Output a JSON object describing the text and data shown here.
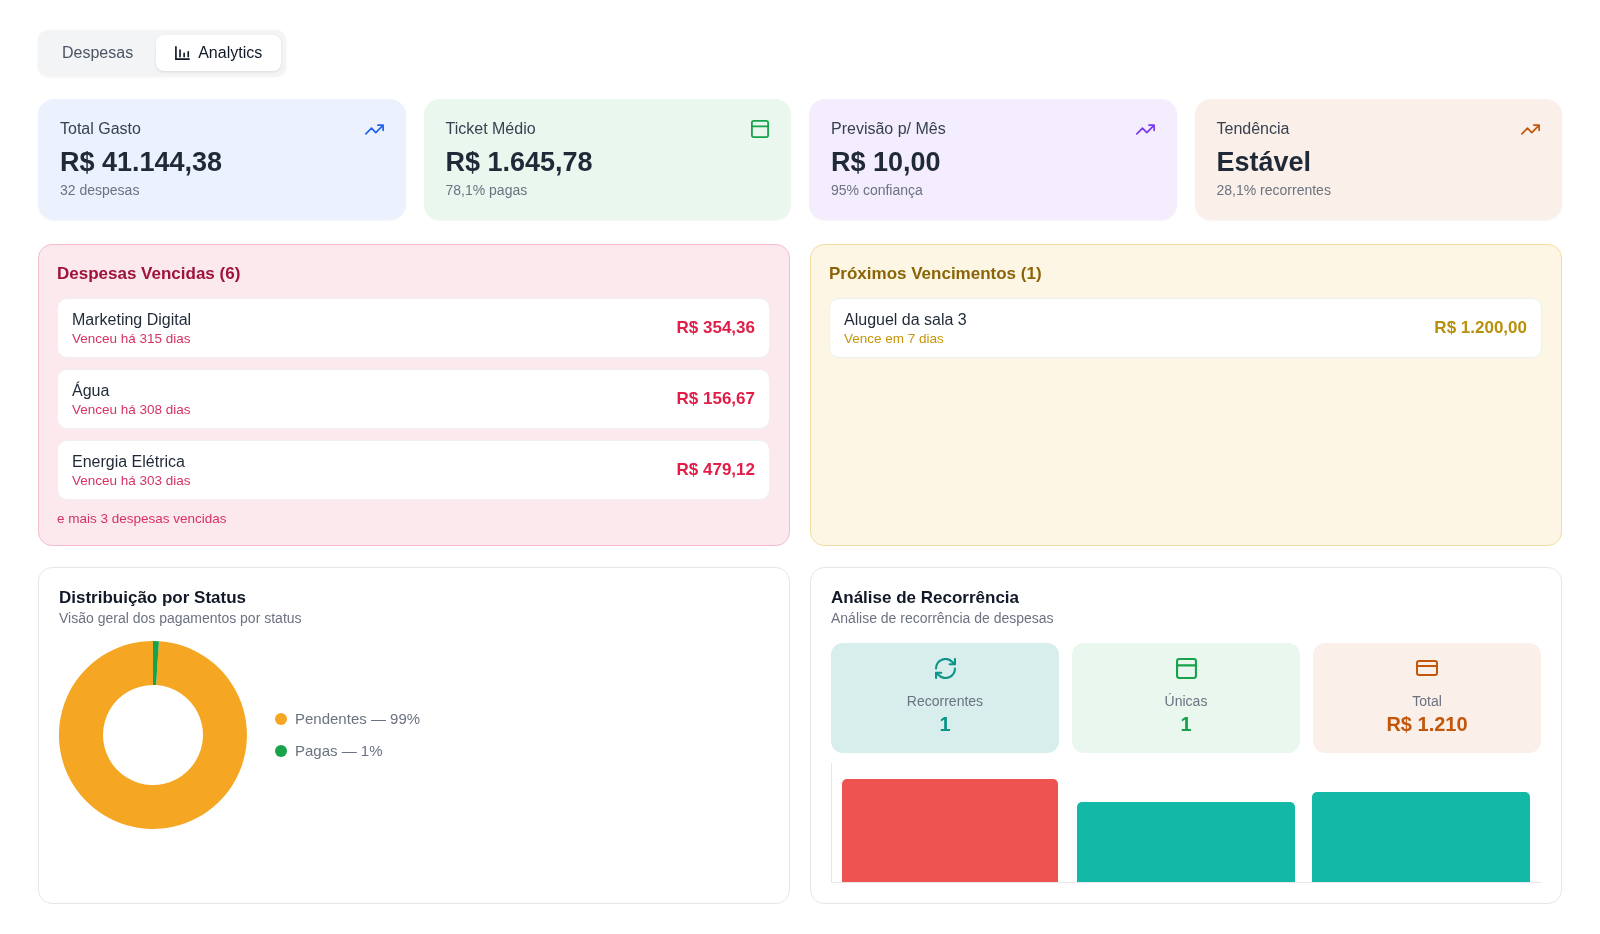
{
  "tabs": [
    {
      "label": "Despesas",
      "selected": false,
      "kind": "plain"
    },
    {
      "label": "Analytics",
      "selected": true,
      "kind": "with-icon"
    }
  ],
  "stats": [
    {
      "title": "Total Gasto",
      "value": "R$ 41.144,38",
      "note": "32 despesas",
      "kind": "trend",
      "color": "#2563eb"
    },
    {
      "title": "Ticket Médio",
      "value": "R$ 1.645,78",
      "note": "78,1% pagas",
      "kind": "window",
      "color": "#16a34a"
    },
    {
      "title": "Previsão p/ Mês",
      "value": "R$ 10,00",
      "note": "95% confiança",
      "kind": "trend",
      "color": "#7c3aed"
    },
    {
      "title": "Tendência",
      "value": "Estável",
      "note": "28,1% recorrentes",
      "kind": "trend",
      "color": "#c2570c"
    }
  ],
  "overdue": {
    "title": "Despesas Vencidas (6)",
    "items": [
      {
        "name": "Marketing Digital",
        "due": "Venceu há 315 dias",
        "amount": "R$ 354,36"
      },
      {
        "name": "Água",
        "due": "Venceu há 308 dias",
        "amount": "R$ 156,67"
      },
      {
        "name": "Energia Elétrica",
        "due": "Venceu há 303 dias",
        "amount": "R$ 479,12"
      }
    ],
    "more": "e mais 3 despesas vencidas"
  },
  "upcoming": {
    "title": "Próximos Vencimentos (1)",
    "items": [
      {
        "name": "Aluguel da sala 3",
        "due": "Vence em 7 dias",
        "amount": "R$ 1.200,00"
      }
    ]
  },
  "distribution": {
    "title": "Distribuição por Status",
    "subtitle": "Visão geral dos pagamentos por status",
    "chart_data": {
      "type": "donut",
      "categories": [
        "Pendentes — 99%",
        "Pagas — 1%"
      ],
      "values": [
        99,
        1
      ],
      "legend": "right"
    },
    "slices": [
      {
        "color": "#f5a623"
      },
      {
        "color": "#16a34a"
      }
    ]
  },
  "recurrence": {
    "title": "Análise de Recorrência",
    "subtitle": "Análise de recorrência de despesas",
    "metrics": [
      {
        "label": "Recorrentes",
        "value": "1",
        "kind": "cycle",
        "color": "#0d9488"
      },
      {
        "label": "Únicas",
        "value": "1",
        "kind": "window",
        "color": "#16a34a"
      },
      {
        "label": "Total",
        "value": "R$ 1.210",
        "kind": "card",
        "color": "#c2570c"
      }
    ]
  }
}
